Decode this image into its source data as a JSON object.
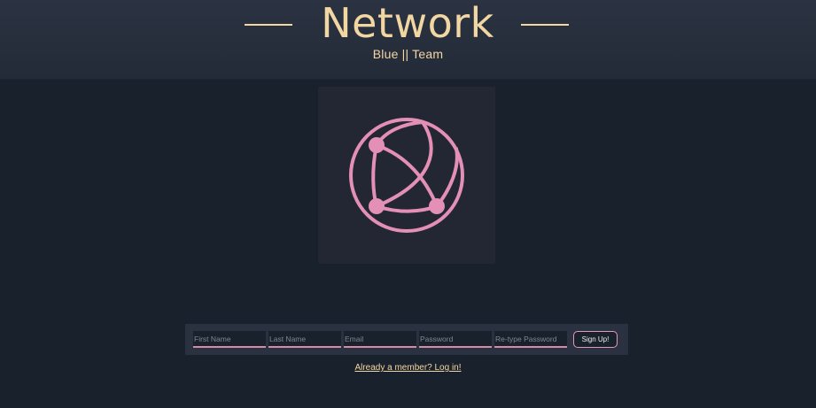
{
  "header": {
    "title": "Network",
    "subtitle": "Blue || Team"
  },
  "logo": {
    "icon": "globe-network-icon",
    "color": "#e38fb6"
  },
  "signup": {
    "first_name_placeholder": "First Name",
    "last_name_placeholder": "Last Name",
    "email_placeholder": "Email",
    "password_placeholder": "Password",
    "retype_password_placeholder": "Re-type Password",
    "submit_label": "Sign Up!"
  },
  "login_link": "Already a member? Log in!",
  "colors": {
    "background": "#18212c",
    "header": "#2b3342",
    "accent_text": "#f3d7a3",
    "accent_pink": "#e38fb6"
  }
}
